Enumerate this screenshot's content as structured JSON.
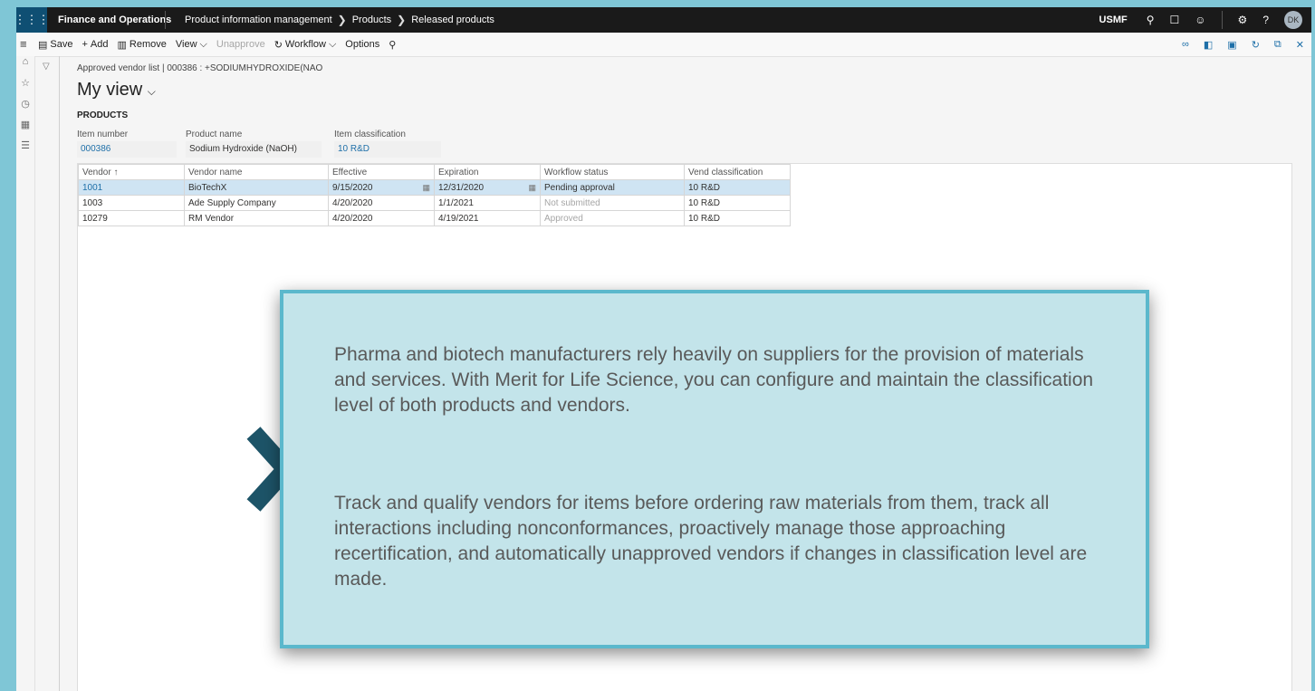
{
  "topbar": {
    "app_name": "Finance and Operations",
    "breadcrumbs": [
      "Product information management",
      "Products",
      "Released products"
    ],
    "company": "USMF",
    "avatar_initials": "DK",
    "icons": [
      "waffle-icon",
      "search-icon",
      "chat-icon",
      "smiley-icon",
      "gear-icon",
      "help-icon"
    ]
  },
  "actionbar": {
    "save": "Save",
    "add": "Add",
    "remove": "Remove",
    "view": "View",
    "unapprove": "Unapprove",
    "workflow": "Workflow",
    "options": "Options"
  },
  "form": {
    "caption": "Approved vendor list | 000386 : +SODIUMHYDROXIDE(NAO",
    "view_name": "My view",
    "section": "PRODUCTS",
    "fields": {
      "item_number_label": "Item number",
      "item_number": "000386",
      "product_name_label": "Product name",
      "product_name": "Sodium Hydroxide (NaOH)",
      "item_class_label": "Item classification",
      "item_class": "10 R&D"
    }
  },
  "grid": {
    "headers": {
      "vendor": "Vendor ↑",
      "vendor_name": "Vendor name",
      "effective": "Effective",
      "expiration": "Expiration",
      "workflow_status": "Workflow status",
      "vend_class": "Vend classification"
    },
    "rows": [
      {
        "vendor": "1001",
        "name": "BioTechX",
        "effective": "9/15/2020",
        "expiration": "12/31/2020",
        "status": "Pending approval",
        "class": "10 R&D"
      },
      {
        "vendor": "1003",
        "name": "Ade Supply Company",
        "effective": "4/20/2020",
        "expiration": "1/1/2021",
        "status": "Not submitted",
        "class": "10 R&D"
      },
      {
        "vendor": "10279",
        "name": "RM Vendor",
        "effective": "4/20/2020",
        "expiration": "4/19/2021",
        "status": "Approved",
        "class": "10 R&D"
      }
    ]
  },
  "callout": {
    "paragraph1": "Pharma and biotech manufacturers rely heavily on suppliers for the provision of materials and services. With Merit for Life Science, you can configure and maintain the classification level of both products and vendors.",
    "paragraph2": "Track and qualify vendors for items before ordering raw materials from them, track all interactions including nonconformances, proactively manage those approaching recertification, and automatically unapproved vendors if changes in classification level are made."
  },
  "colors": {
    "background": "#7fc6d6",
    "callout_fill": "#c3e4ea",
    "callout_border": "#5bb8cc",
    "chevron": "#1d5468",
    "link": "#1e6fa8",
    "selected_row": "#cfe4f3"
  }
}
